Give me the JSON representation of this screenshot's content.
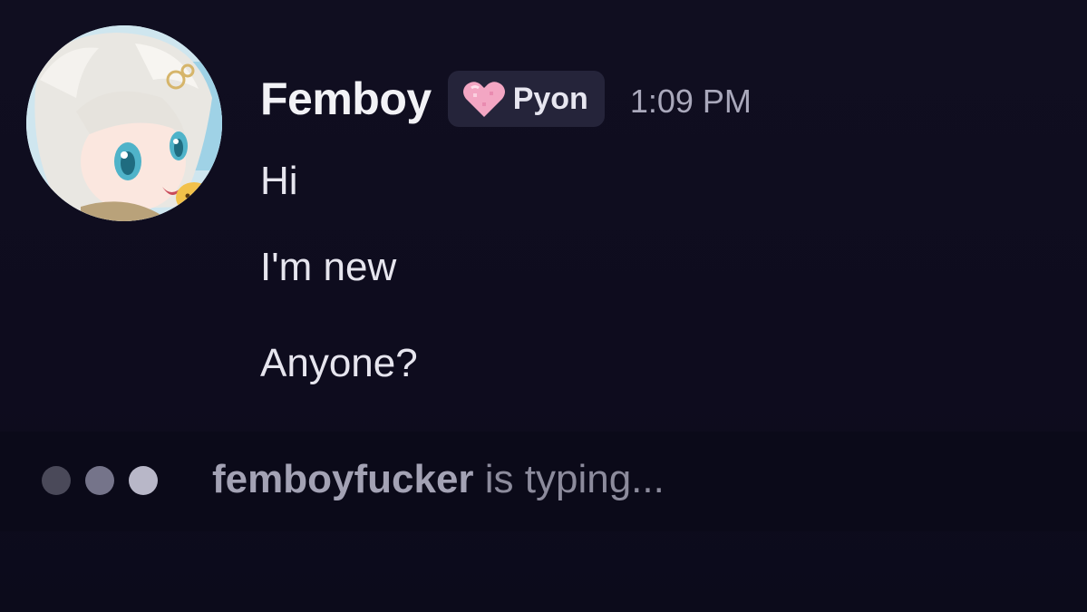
{
  "message": {
    "author": "Femboy",
    "role_tag": {
      "icon": "pink-heart-icon",
      "label": "Pyon"
    },
    "timestamp": "1:09 PM",
    "lines": [
      "Hi",
      "I'm new",
      "Anyone?"
    ]
  },
  "typing_indicator": {
    "user": "femboyfucker",
    "suffix": " is typing..."
  },
  "colors": {
    "background": "#0f0d1f",
    "tag_background": "#25243a",
    "heart": "#f3a6c3"
  }
}
